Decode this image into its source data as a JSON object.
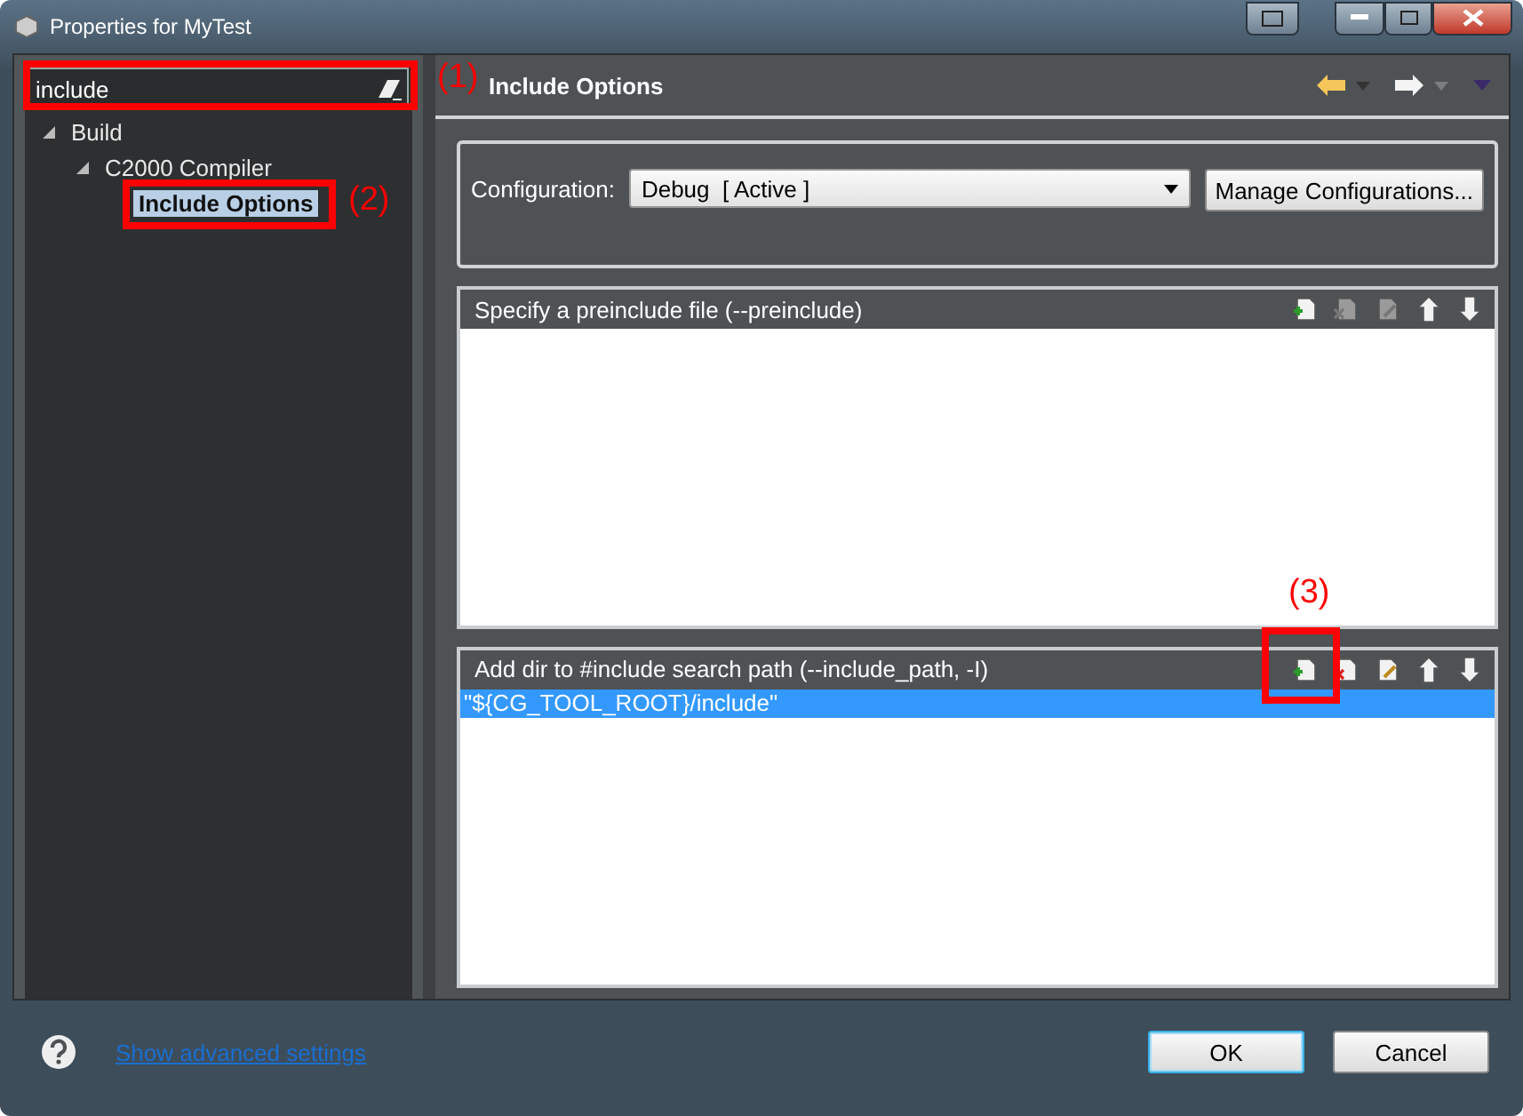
{
  "window": {
    "title": "Properties for MyTest"
  },
  "filter": {
    "value": "include"
  },
  "tree": [
    {
      "label": "Build",
      "expanded": true,
      "selected": false,
      "children": [
        {
          "label": "C2000 Compiler",
          "expanded": true,
          "selected": false,
          "children": [
            {
              "label": "Include Options",
              "selected": true
            }
          ]
        }
      ]
    }
  ],
  "page_title": "Include Options",
  "configuration": {
    "label": "Configuration:",
    "value": "Debug  [ Active ]",
    "button": "Manage Configurations..."
  },
  "sections": [
    {
      "title": "Specify a preinclude file (--preinclude)",
      "tools": [
        {
          "kind": "add",
          "disabled": false
        },
        {
          "kind": "delete",
          "disabled": true
        },
        {
          "kind": "edit",
          "disabled": true
        },
        {
          "kind": "up",
          "disabled": false
        },
        {
          "kind": "down",
          "disabled": false
        }
      ]
    },
    {
      "title": "Add dir to #include search path (--include_path, -I)",
      "tools": [
        {
          "kind": "add",
          "disabled": false
        },
        {
          "kind": "delete",
          "disabled": false
        },
        {
          "kind": "edit",
          "disabled": false
        },
        {
          "kind": "up",
          "disabled": false
        },
        {
          "kind": "down",
          "disabled": false
        }
      ],
      "items": [
        {
          "text": "\"${CG_TOOL_ROOT}/include\"",
          "selected": true
        }
      ]
    }
  ],
  "annotations": [
    "(1)",
    "(2)",
    "(3)"
  ],
  "footer": {
    "link": "Show advanced settings",
    "buttons": [
      {
        "label": "OK",
        "default": true
      },
      {
        "label": "Cancel",
        "default": false
      }
    ]
  }
}
